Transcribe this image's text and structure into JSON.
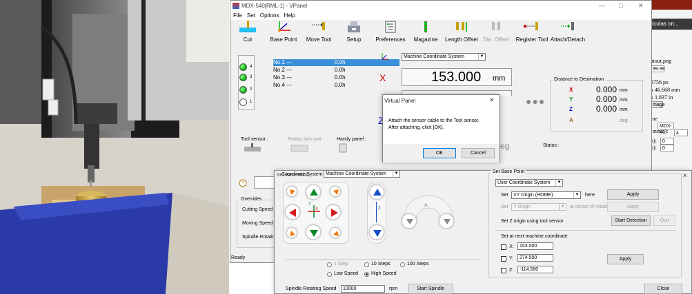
{
  "vpanel": {
    "title": "MDX-540[RML-1] - VPanel",
    "menu": [
      "File",
      "Set",
      "Options",
      "Help"
    ],
    "toolbar": [
      "Cut",
      "Base Point",
      "Move Tool",
      "Setup",
      "Preferences",
      "Magazine",
      "Length Offset",
      "Dia. Offset",
      "Register Tool",
      "Attach/Detach"
    ],
    "tools": [
      {
        "name": "No.1  ---",
        "time": "0.0h"
      },
      {
        "name": "No.2  ---",
        "time": "0.0h"
      },
      {
        "name": "No.3  ---",
        "time": "0.0h"
      },
      {
        "name": "No.4  ---",
        "time": "0.0h"
      }
    ],
    "lamp_numbers": [
      "4",
      "3",
      "2",
      "1"
    ],
    "coord_system": "Machine Coordinate System",
    "x_label": "X",
    "x_value": "153.000",
    "y_value_partial": "274.500",
    "z_label": "Z",
    "unit_mm": "mm",
    "distance_title": "Distance to Destination",
    "distance": [
      {
        "axis": "X",
        "value": "0.000",
        "unit": "mm",
        "color": "#cc0000"
      },
      {
        "axis": "Y",
        "value": "0.000",
        "unit": "mm",
        "color": "#008800"
      },
      {
        "axis": "Z",
        "value": "0.000",
        "unit": "mm",
        "color": "#0000cc"
      },
      {
        "axis": "A",
        "value": "",
        "unit": "deg",
        "color": "#996633"
      }
    ],
    "tool_sensor": "Tool sensor :",
    "rotary_axis_unit": "Rotary axis unit",
    "handy_panel": "Handy panel :",
    "status": "Status :",
    "overrides": "Overrides",
    "cutting_speed": "Cutting Speed :",
    "moving_speed": "Moving Speed",
    "spindle_rotating": "Spindle Rotating",
    "ready": "Ready",
    "partial_text": "eg"
  },
  "virtual_panel": {
    "title": "Virtual Panel",
    "message_line1": "Attach the sensor cable to the Tool sensor.",
    "message_line2": "After attaching, click [OK].",
    "ok": "OK",
    "cancel": "Cancel"
  },
  "set_base_point_dialog": {
    "title": "Set Base Point",
    "coord_label": "Coordinate System",
    "coord_value": "Machine Coordinate System",
    "step_options": [
      "1 Step",
      "10 Steps",
      "100 Steps"
    ],
    "speed_options": [
      "Low Speed",
      "High Speed"
    ],
    "spindle_label": "Spindle Rotating Speed",
    "spindle_value": "10000",
    "spindle_unit": "rpm",
    "start_spindle": "Start Spindle",
    "group_title": "Set Base Point",
    "user_coord": "User Coordinate System",
    "set_label": "Set",
    "xy_origin": "XY Origin (HOME)",
    "here": "here",
    "apply": "Apply",
    "y_origin": "Y Origin",
    "at_center": "at center of rotation",
    "z_sensor": "Set Z origin using tool sensor",
    "start_detection": "Start Detection",
    "quit": "Quit",
    "next_machine": "Set at next machine coordinate",
    "x_label": "X:",
    "x_value": "153.000",
    "y_label": "Y:",
    "y_value": "274.500",
    "z_label": "Z:",
    "z_value": "-114.580",
    "close": "Close",
    "jog_z_label": "Z",
    "jog_x_label": "X",
    "jog_y_label": "Y",
    "jog_a_label": "A"
  },
  "background_window": {
    "tab": "ículas on...",
    "file_name": "atout.png",
    "price": "99.99",
    "px": "2756 px",
    "mm1": "x 46.668 mm",
    "mm2": "x 1.837 in",
    "image_btn": "mage",
    "machine_label": "ine",
    "machine_value": "MDX-40",
    "speed_label": "(mm/s):",
    "speed_value": "4",
    "f1_label": "n):",
    "f1_value": "0",
    "f2_label": "n):",
    "f2_value": "0"
  },
  "colors": {
    "selection": "#3b8fd9",
    "jog_green": "#0a8a2a",
    "jog_red": "#d41a1a",
    "jog_blue": "#1a4fcc",
    "jog_orange": "#f07a10"
  }
}
